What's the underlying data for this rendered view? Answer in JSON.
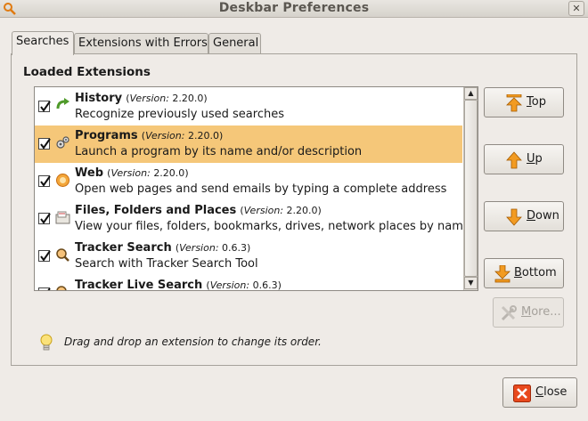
{
  "window": {
    "title": "Deskbar Preferences"
  },
  "tabs": [
    {
      "label": "Searches",
      "active": true
    },
    {
      "label": "Extensions with Errors",
      "active": false
    },
    {
      "label": "General",
      "active": false
    }
  ],
  "section_title": "Loaded Extensions",
  "version_word": "Version:",
  "extensions": [
    {
      "name": "History",
      "version": "2.20.0",
      "description": "Recognize previously used searches",
      "checked": true,
      "icon": "history-arrow-icon"
    },
    {
      "name": "Programs",
      "version": "2.20.0",
      "description": "Launch a program by its name and/or description",
      "checked": true,
      "icon": "programs-gears-icon",
      "selected": true
    },
    {
      "name": "Web",
      "version": "2.20.0",
      "description": "Open web pages and send emails by typing a complete address",
      "checked": true,
      "icon": "web-browser-icon"
    },
    {
      "name": "Files, Folders and Places",
      "version": "2.20.0",
      "description": "View your files, folders, bookmarks, drives, network places by name",
      "checked": true,
      "icon": "file-folder-icon"
    },
    {
      "name": "Tracker Search",
      "version": "0.6.3",
      "description": "Search with Tracker Search Tool",
      "checked": true,
      "icon": "tracker-search-icon"
    },
    {
      "name": "Tracker Live Search",
      "version": "0.6.3",
      "description": "",
      "checked": true,
      "icon": "tracker-live-search-icon"
    }
  ],
  "buttons": {
    "top": {
      "prefix": "",
      "mnemonic": "T",
      "rest": "op"
    },
    "up": {
      "prefix": "",
      "mnemonic": "U",
      "rest": "p"
    },
    "down": {
      "prefix": "",
      "mnemonic": "D",
      "rest": "own"
    },
    "bottom": {
      "prefix": "",
      "mnemonic": "B",
      "rest": "ottom"
    },
    "more": {
      "prefix": "",
      "mnemonic": "M",
      "rest": "ore..."
    },
    "close": {
      "prefix": "",
      "mnemonic": "C",
      "rest": "lose"
    }
  },
  "hint": "Drag and drop an extension to change its order.",
  "colors": {
    "selection": "#f5c779",
    "accent_orange": "#f29b22"
  }
}
